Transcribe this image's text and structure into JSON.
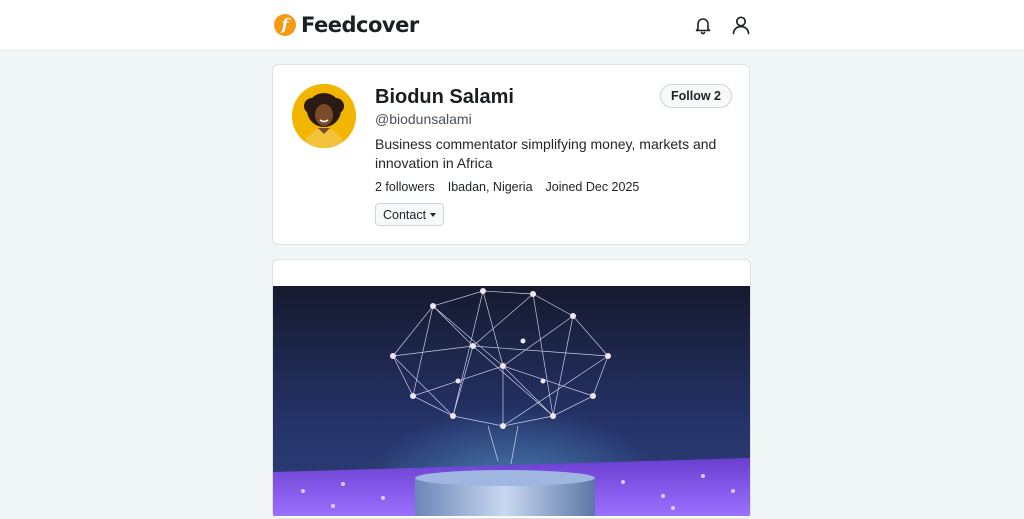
{
  "header": {
    "brand_name": "Feedcover",
    "logo_letter": "f",
    "icons": [
      "bell-icon",
      "user-icon"
    ]
  },
  "profile": {
    "name": "Biodun Salami",
    "handle": "@biodunsalami",
    "bio": "Business commentator simplifying money, markets and innovation in Africa",
    "followers": "2 followers",
    "location": "Ibadan, Nigeria",
    "joined": "Joined Dec 2025",
    "contact_label": "Contact",
    "follow_label": "Follow 2"
  },
  "colors": {
    "brand_accent": "#f59a14",
    "page_background": "#f1f6f6"
  }
}
